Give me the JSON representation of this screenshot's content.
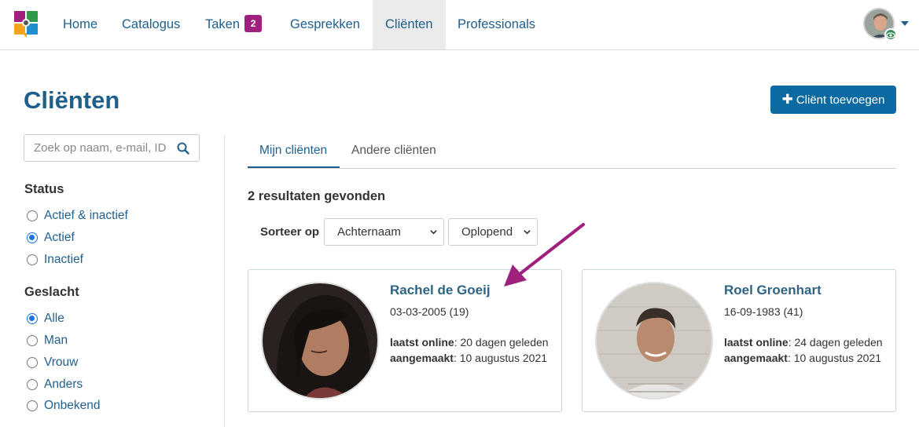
{
  "nav": {
    "items": [
      {
        "label": "Home"
      },
      {
        "label": "Catalogus"
      },
      {
        "label": "Taken",
        "badge": "2"
      },
      {
        "label": "Gesprekken"
      },
      {
        "label": "Cliënten",
        "active": true
      },
      {
        "label": "Professionals"
      }
    ],
    "logo_icon": "app-logo-icon",
    "avatar_icon": "user-avatar",
    "colors": {
      "link": "#1f5f8b",
      "badge": "#a0207e",
      "active_bg": "#ebebeb"
    }
  },
  "page": {
    "title": "Cliënten",
    "add_button": "Cliënt toevoegen",
    "add_button_color": "#0b6aa1"
  },
  "sidebar": {
    "search_placeholder": "Zoek op naam, e-mail, ID",
    "status": {
      "title": "Status",
      "options": [
        {
          "label": "Actief & inactief",
          "checked": false
        },
        {
          "label": "Actief",
          "checked": true
        },
        {
          "label": "Inactief",
          "checked": false
        }
      ]
    },
    "gender": {
      "title": "Geslacht",
      "options": [
        {
          "label": "Alle",
          "checked": true
        },
        {
          "label": "Man",
          "checked": false
        },
        {
          "label": "Vrouw",
          "checked": false
        },
        {
          "label": "Anders",
          "checked": false
        },
        {
          "label": "Onbekend",
          "checked": false
        }
      ]
    }
  },
  "tabs": [
    {
      "label": "Mijn cliënten",
      "active": true
    },
    {
      "label": "Andere cliënten",
      "active": false
    }
  ],
  "results_text": "2 resultaten gevonden",
  "sort": {
    "label": "Sorteer op",
    "field": "Achternaam",
    "order": "Oplopend"
  },
  "clients": [
    {
      "name": "Rachel de Goeij",
      "dob": "03-03-2005 (19)",
      "last_online_label": "laatst online",
      "last_online": ": 20 dagen geleden",
      "created_label": "aangemaakt",
      "created": ": 10 augustus 2021"
    },
    {
      "name": "Roel Groenhart",
      "dob": "16-09-1983 (41)",
      "last_online_label": "laatst online",
      "last_online": ": 24 dagen geleden",
      "created_label": "aangemaakt",
      "created": ": 10 augustus 2021"
    }
  ],
  "annotation_arrow_color": "#a0207e"
}
